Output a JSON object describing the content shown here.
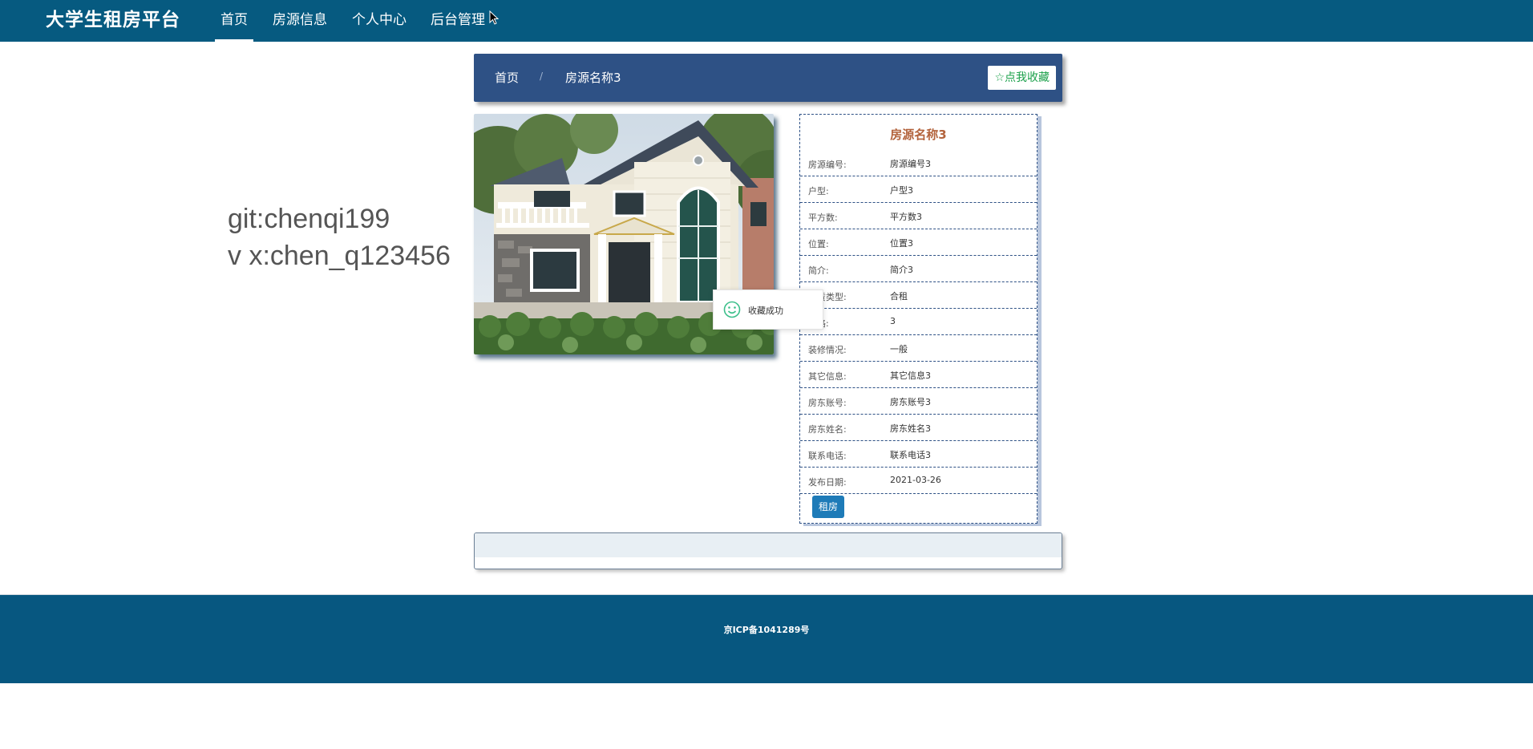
{
  "nav": {
    "brand": "大学生租房平台",
    "items": [
      {
        "label": "首页",
        "active": true
      },
      {
        "label": "房源信息",
        "active": false
      },
      {
        "label": "个人中心",
        "active": false
      },
      {
        "label": "后台管理",
        "active": false
      }
    ]
  },
  "side_note": {
    "line1": "git:chenqi199",
    "line2": "v x:chen_q123456"
  },
  "breadcrumb": {
    "home": "首页",
    "separator": "/",
    "current": "房源名称3",
    "favorite_button": "☆点我收藏"
  },
  "detail": {
    "title": "房源名称3",
    "rows": [
      {
        "label": "房源编号:",
        "value": "房源编号3"
      },
      {
        "label": "户型:",
        "value": "户型3"
      },
      {
        "label": "平方数:",
        "value": "平方数3"
      },
      {
        "label": "位置:",
        "value": "位置3"
      },
      {
        "label": "简介:",
        "value": "简介3"
      },
      {
        "label": "租赁类型:",
        "value": "合租"
      },
      {
        "label": "价格:",
        "value": "3"
      },
      {
        "label": "装修情况:",
        "value": "一般"
      },
      {
        "label": "其它信息:",
        "value": "其它信息3"
      },
      {
        "label": "房东账号:",
        "value": "房东账号3"
      },
      {
        "label": "房东姓名:",
        "value": "房东姓名3"
      },
      {
        "label": "联系电话:",
        "value": "联系电话3"
      },
      {
        "label": "发布日期:",
        "value": "2021-03-26"
      }
    ],
    "rent_button": "租房"
  },
  "toast": {
    "message": "收藏成功",
    "icon": "smile-icon"
  },
  "footer": {
    "icp": "京ICP备1041289号"
  },
  "colors": {
    "nav_bg": "#065a80",
    "breadcrumb_bg": "#2e5185",
    "title_color": "#b3633c",
    "button_bg": "#1e7bb8",
    "favorite_text": "#1aa04a"
  }
}
